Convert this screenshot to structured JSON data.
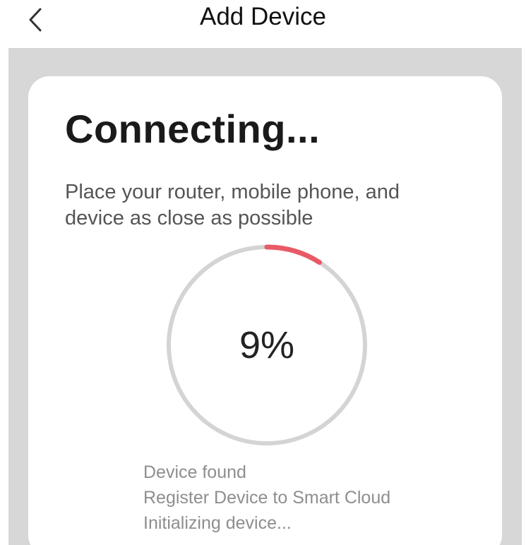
{
  "header": {
    "back_icon": "chevron-left-icon",
    "title": "Add Device"
  },
  "card": {
    "heading": "Connecting...",
    "instructions": "Place your router, mobile phone, and device as close as possible",
    "progress": {
      "label": "9%",
      "fraction": 0.09,
      "track_color": "#d4d4d4",
      "fill_color": "#e85a66"
    },
    "status_steps": [
      "Device found",
      "Register Device to Smart Cloud",
      "Initializing device..."
    ]
  },
  "colors": {
    "background": "#d7d7d7",
    "card": "#ffffff"
  }
}
